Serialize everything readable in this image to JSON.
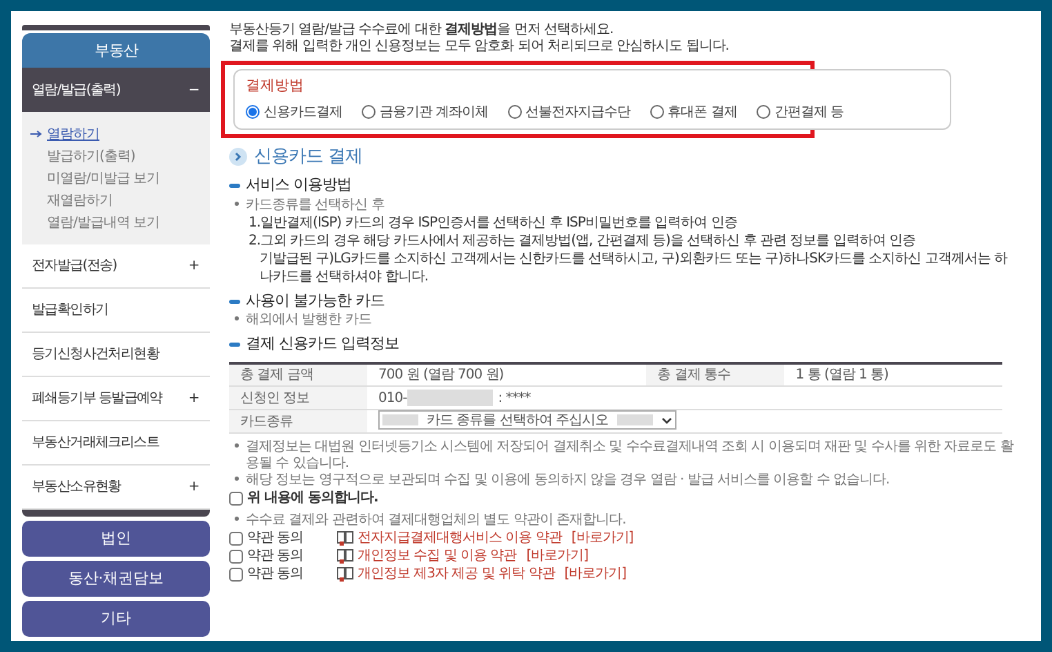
{
  "sidebar": {
    "header": "부동산",
    "menu": [
      {
        "label": "열람/발급(출력)",
        "toggle": "−",
        "expanded": true,
        "children": [
          {
            "label": "열람하기",
            "selected": true
          },
          {
            "label": "발급하기(출력)",
            "selected": false
          },
          {
            "label": "미열람/미발급 보기",
            "selected": false
          },
          {
            "label": "재열람하기",
            "selected": false
          },
          {
            "label": "열람/발급내역 보기",
            "selected": false
          }
        ]
      },
      {
        "label": "전자발급(전송)",
        "toggle": "+",
        "expanded": false
      },
      {
        "label": "발급확인하기",
        "expanded": false
      },
      {
        "label": "등기신청사건처리현황",
        "expanded": false
      },
      {
        "label": "폐쇄등기부 등발급예약",
        "toggle": "+",
        "expanded": false
      },
      {
        "label": "부동산거래체크리스트",
        "expanded": false
      },
      {
        "label": "부동산소유현황",
        "toggle": "+",
        "expanded": false
      }
    ],
    "buttons": [
      "법인",
      "동산·채권담보",
      "기타"
    ]
  },
  "intro": [
    "부동산등기 열람/발급 수수료에 대한 **결제방법**을 먼저 선택하세요.",
    "결제를 위해 입력한 개인 신용정보는 모두 암호화 되어 처리되므로 안심하시도 됩니다."
  ],
  "payment_method": {
    "title": "결제방법",
    "options": [
      {
        "label": "신용카드결제",
        "selected": true
      },
      {
        "label": "금융기관 계좌이체",
        "selected": false
      },
      {
        "label": "선불전자지급수단",
        "selected": false
      },
      {
        "label": "휴대폰 결제",
        "selected": false
      },
      {
        "label": "간편결제 등",
        "selected": false
      }
    ]
  },
  "section_title": "신용카드 결제",
  "usage": {
    "title": "서비스 이용방법",
    "bullet": "카드종류를 선택하신 후",
    "steps": [
      "1.일반결제(ISP) 카드의 경우 ISP인증서를 선택하신 후 ISP비밀번호를 입력하여 인증",
      "2.그외 카드의 경우 해당 카드사에서 제공하는 결제방법(앱, 간편결제 등)을 선택하신 후 관련 정보를 입력하여 인증"
    ],
    "note": "기발급된 구)LG카드를 소지하신 고객께서는 신한카드를 선택하시고, 구)외환카드 또는 구)하나SK카드를 소지하신 고객께서는 하나카드를 선택하셔야 합니다."
  },
  "unavailable": {
    "title": "사용이 불가능한 카드",
    "bullet": "해외에서 발행한 카드"
  },
  "card_info": {
    "title": "결제 신용카드 입력정보",
    "total_amount_label": "총 결제 금액",
    "total_amount": "700 원 (열람 700 원)",
    "total_count_label": "총 결제 통수",
    "total_count": "1 통 (열람 1 통)",
    "applicant_label": "신청인 정보",
    "applicant_prefix": "010-",
    "applicant_suffix": ": ****",
    "card_type_label": "카드종류",
    "card_type_placeholder": "카드 종류를 선택하여 주십시오"
  },
  "notes": [
    "결제정보는 대법원 인터넷등기소 시스템에 저장되어 결제취소 및 수수료결제내역 조회 시 이용되며 재판 및 수사를 위한 자료로도 활용될 수 있습니다.",
    "해당 정보는 영구적으로 보관되며 수집 및 이용에 동의하지 않을 경우 열람 · 발급 서비스를 이용할 수 없습니다."
  ],
  "agree": {
    "label": "위 내용에 동의합니다.",
    "checked": false
  },
  "terms_note": "수수료 결제와 관련하여 결제대행업체의 별도 약관이 존재합니다.",
  "terms": [
    {
      "label": "약관 동의",
      "checked": false,
      "link": "전자지급결제대행서비스 이용 약관",
      "go": "[바로가기]"
    },
    {
      "label": "약관 동의",
      "checked": false,
      "link": "개인정보 수집 및 이용 약관",
      "go": "[바로가기]"
    },
    {
      "label": "약관 동의",
      "checked": false,
      "link": "개인정보 제3자 제공 및 위탁 약관",
      "go": "[바로가기]"
    }
  ]
}
